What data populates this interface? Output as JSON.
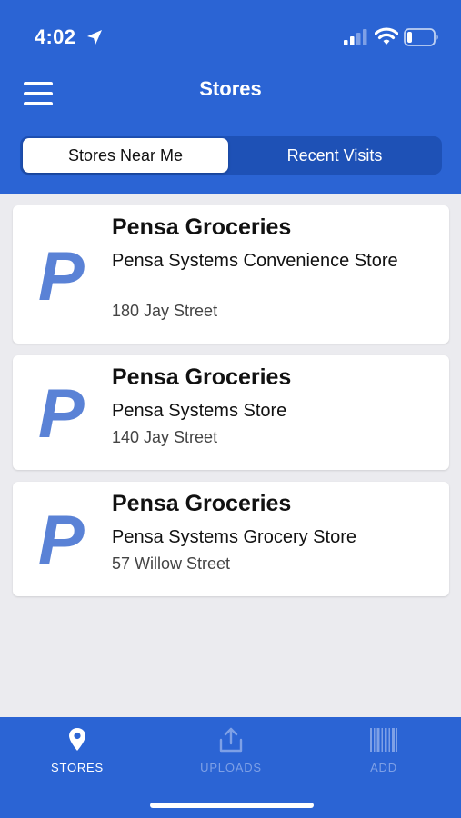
{
  "status_bar": {
    "time": "4:02",
    "icons": [
      "location-arrow-icon",
      "cellular-signal-icon",
      "wifi-icon",
      "battery-icon"
    ]
  },
  "header": {
    "title": "Stores",
    "menu_icon": "hamburger-menu-icon"
  },
  "segmented_control": {
    "tabs": [
      {
        "label": "Stores Near Me",
        "selected": true
      },
      {
        "label": "Recent Visits",
        "selected": false
      }
    ]
  },
  "stores": [
    {
      "logo": "P",
      "chain": "Pensa Groceries",
      "name": "Pensa Systems Convenience Store",
      "address": "180 Jay Street"
    },
    {
      "logo": "P",
      "chain": "Pensa Groceries",
      "name": "Pensa Systems Store",
      "address": "140 Jay Street"
    },
    {
      "logo": "P",
      "chain": "Pensa Groceries",
      "name": "Pensa Systems Grocery Store",
      "address": "57 Willow Street"
    }
  ],
  "tab_bar": {
    "items": [
      {
        "label": "STORES",
        "icon": "map-pin-icon",
        "active": true
      },
      {
        "label": "UPLOADS",
        "icon": "upload-icon",
        "active": false
      },
      {
        "label": "ADD",
        "icon": "barcode-icon",
        "active": false
      }
    ]
  },
  "colors": {
    "brand_blue": "#2b64d4",
    "segmented_bg": "#1e51b6",
    "logo_blue": "#5a82d6",
    "inactive_tab": "#7ea0e6",
    "background": "#ebebef"
  }
}
